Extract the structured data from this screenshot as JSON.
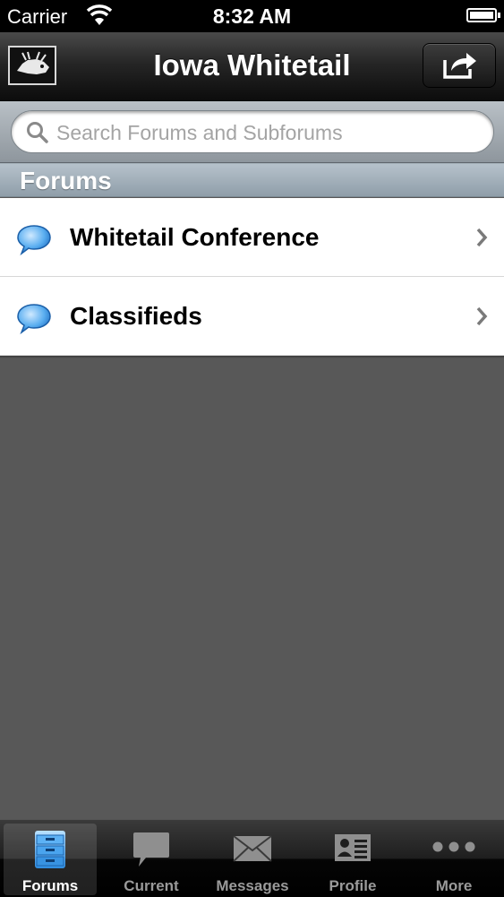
{
  "status_bar": {
    "carrier": "Carrier",
    "time": "8:32 AM"
  },
  "nav": {
    "title": "Iowa Whitetail"
  },
  "search": {
    "placeholder": "Search Forums and Subforums",
    "value": ""
  },
  "section": {
    "title": "Forums"
  },
  "forums": [
    {
      "label": "Whitetail Conference",
      "icon": "speech-bubble-icon"
    },
    {
      "label": "Classifieds",
      "icon": "speech-bubble-icon"
    }
  ],
  "tabs": [
    {
      "label": "Forums",
      "icon": "file-cabinet-icon",
      "active": true
    },
    {
      "label": "Current",
      "icon": "speech-bubble-icon"
    },
    {
      "label": "Messages",
      "icon": "envelope-icon"
    },
    {
      "label": "Profile",
      "icon": "id-card-icon"
    },
    {
      "label": "More",
      "icon": "ellipsis-icon"
    }
  ],
  "colors": {
    "accent": "#2f8de0",
    "background": "#585858",
    "nav": "#1a1a1a"
  }
}
